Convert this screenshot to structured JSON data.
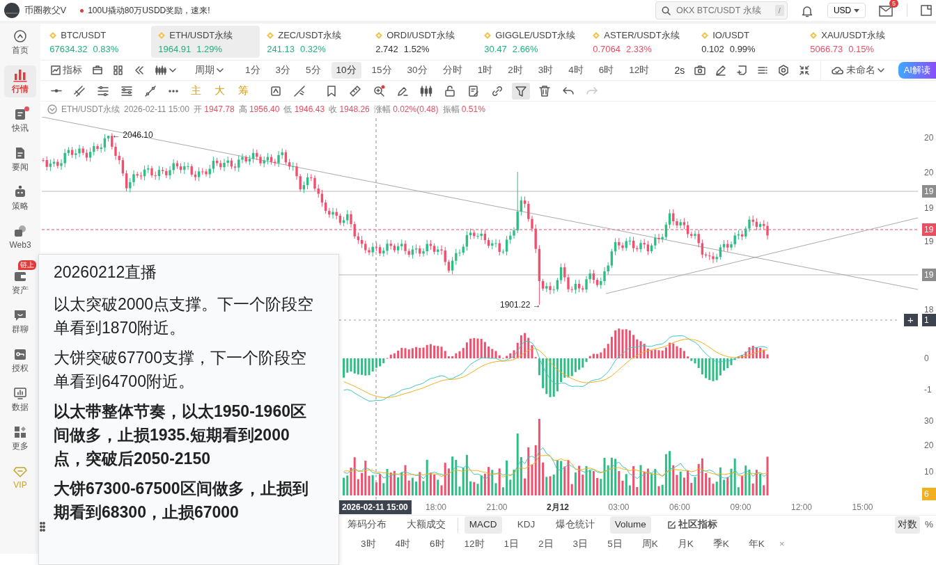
{
  "header": {
    "channel_name": "币圈教父V",
    "notice": "100U撬动80万USDD奖励，速来!",
    "search": {
      "placeholder": "OKX BTC/USDT 永续",
      "shortcut": "/"
    },
    "currency": "USD",
    "mail_badge": "5"
  },
  "sidebar": {
    "items": [
      {
        "label": "首页",
        "kind": "home",
        "selected": false,
        "unread": false
      },
      {
        "label": "行情",
        "kind": "market",
        "selected": true,
        "unread": false
      },
      {
        "label": "快讯",
        "kind": "flash",
        "selected": false,
        "unread": true
      },
      {
        "label": "要闻",
        "kind": "news",
        "selected": false,
        "unread": false
      },
      {
        "label": "策略",
        "kind": "strategy",
        "selected": false,
        "unread": false
      },
      {
        "label": "Web3",
        "kind": "web3",
        "selected": false,
        "unread": false
      },
      {
        "label": "资产",
        "kind": "assets",
        "selected": false,
        "unread": false,
        "badge": "链上"
      },
      {
        "label": "群聊",
        "kind": "chat",
        "selected": false,
        "unread": false
      },
      {
        "label": "授权",
        "kind": "auth",
        "selected": false,
        "unread": false
      },
      {
        "label": "数据",
        "kind": "data",
        "selected": false,
        "unread": false
      },
      {
        "label": "更多",
        "kind": "more",
        "selected": false,
        "unread": false
      },
      {
        "label": "VIP",
        "kind": "vip",
        "selected": false,
        "unread": false
      }
    ]
  },
  "tickers": [
    {
      "symbol": "BTC/USDT",
      "price": "67634.32",
      "change": "0.83%",
      "color": "#1db27c",
      "selected": false
    },
    {
      "symbol": "ETH/USDT永续",
      "price": "1964.91",
      "change": "1.29%",
      "color": "#1db27c",
      "selected": true
    },
    {
      "symbol": "ZEC/USDT永续",
      "price": "241.13",
      "change": "0.32%",
      "color": "#1db27c",
      "selected": false
    },
    {
      "symbol": "ORDI/USDT永续",
      "price": "2.742",
      "change": "1.52%",
      "color": "#333333",
      "selected": false
    },
    {
      "symbol": "GIGGLE/USDT永续",
      "price": "30.47",
      "change": "2.66%",
      "color": "#1db27c",
      "selected": false
    },
    {
      "symbol": "ASTER/USDT永续",
      "price": "0.7064",
      "change": "2.33%",
      "color": "#e84f63",
      "selected": false
    },
    {
      "symbol": "IO/USDT",
      "price": "0.102",
      "change": "0.99%",
      "color": "#333333",
      "selected": false
    },
    {
      "symbol": "XAU/USDT永续",
      "price": "5066.73",
      "change": "0.15%",
      "color": "#e84f63",
      "selected": false
    }
  ],
  "toolbar": {
    "indicator_label": "指标",
    "period_label": "周期",
    "periods": [
      {
        "label": "1分",
        "selected": false
      },
      {
        "label": "3分",
        "selected": false
      },
      {
        "label": "5分",
        "selected": false
      },
      {
        "label": "10分",
        "selected": true
      },
      {
        "label": "15分",
        "selected": false
      },
      {
        "label": "30分",
        "selected": false
      },
      {
        "label": "分时",
        "selected": false
      },
      {
        "label": "1时",
        "selected": false
      },
      {
        "label": "2时",
        "selected": false
      },
      {
        "label": "3时",
        "selected": false
      },
      {
        "label": "4时",
        "selected": false
      },
      {
        "label": "6时",
        "selected": false
      },
      {
        "label": "12时",
        "selected": false
      }
    ],
    "refresh": "2s",
    "layout_name": "未命名",
    "ai_button": "AI解读"
  },
  "drawing_tools": [
    {
      "kind": "hline",
      "selected": false,
      "disabled": false
    },
    {
      "kind": "parallel",
      "selected": false,
      "disabled": false
    },
    {
      "kind": "channel",
      "selected": false,
      "disabled": false
    },
    {
      "kind": "levels",
      "selected": false,
      "disabled": false
    },
    {
      "kind": "trend",
      "selected": false,
      "disabled": false
    },
    {
      "kind": "more",
      "selected": false,
      "disabled": false
    },
    {
      "kind": "text",
      "label": "主",
      "selected": false,
      "disabled": false
    },
    {
      "kind": "text",
      "label": "大",
      "selected": false,
      "disabled": false
    },
    {
      "kind": "text",
      "label": "筹",
      "selected": false,
      "disabled": false
    },
    {
      "kind": "rotate",
      "selected": false,
      "disabled": false
    },
    {
      "kind": "measure",
      "selected": false,
      "disabled": false
    },
    {
      "kind": "bookmark",
      "selected": false,
      "disabled": false
    },
    {
      "kind": "ruler",
      "selected": false,
      "disabled": false
    },
    {
      "kind": "zoom",
      "selected": false,
      "disabled": false
    },
    {
      "kind": "pen",
      "selected": false,
      "disabled": false
    },
    {
      "kind": "candles",
      "selected": false,
      "disabled": false
    },
    {
      "kind": "lock",
      "selected": false,
      "disabled": false
    },
    {
      "kind": "note",
      "selected": false,
      "disabled": false
    },
    {
      "kind": "link",
      "selected": false,
      "disabled": false
    },
    {
      "kind": "filter",
      "selected": true,
      "disabled": false
    },
    {
      "kind": "trash",
      "selected": false,
      "disabled": false
    },
    {
      "kind": "undo",
      "selected": false,
      "disabled": false
    },
    {
      "kind": "redo",
      "selected": false,
      "disabled": true
    }
  ],
  "chart": {
    "symbol": "ETH/USDT永续",
    "datetime": "2026-02-11 15:00",
    "fields": [
      {
        "label": "开",
        "value": "1947.78"
      },
      {
        "label": "高",
        "value": "1956.40"
      },
      {
        "label": "低",
        "value": "1946.43"
      },
      {
        "label": "收",
        "value": "1948.26"
      },
      {
        "label": "涨幅",
        "value": "0.02%(0.48)"
      },
      {
        "label": "振幅",
        "value": "0.51%"
      }
    ],
    "high_label": "← 2046.10",
    "low_label": "1901.22 →",
    "price_axis": [
      {
        "text": "20",
        "kind": "plain"
      },
      {
        "text": "20",
        "kind": "plain"
      },
      {
        "text": "19",
        "kind": "gray-tag"
      },
      {
        "text": "19",
        "kind": "plain"
      },
      {
        "text": "19",
        "kind": "red-tag"
      },
      {
        "text": "19",
        "kind": "plain"
      },
      {
        "text": "19",
        "kind": "gray-tag"
      },
      {
        "text": "18",
        "kind": "plain"
      },
      {
        "text": "1",
        "kind": "dark-tag"
      }
    ],
    "crosshair_add": "+",
    "macd_axis": [
      "0",
      "-1"
    ],
    "volume_axis": [
      {
        "text": "30",
        "kind": "plain"
      },
      {
        "text": "20",
        "kind": "plain"
      },
      {
        "text": "10",
        "kind": "plain"
      },
      {
        "text": "6",
        "kind": "yellow-tag"
      }
    ],
    "crosshair_time": "2026-02-11 15:00",
    "time_axis": [
      {
        "text": "18:00",
        "bold": false
      },
      {
        "text": "21:00",
        "bold": false
      },
      {
        "text": "2月12",
        "bold": true
      },
      {
        "text": "03:00",
        "bold": false
      },
      {
        "text": "06:00",
        "bold": false
      },
      {
        "text": "09:00",
        "bold": false
      },
      {
        "text": "12:00",
        "bold": false
      },
      {
        "text": "15:00",
        "bold": false
      }
    ]
  },
  "note": {
    "title": "20260212直播",
    "paragraphs": [
      {
        "text": "以太突破2000点支撑。下一个阶段空单看到1870附近。",
        "bold": false
      },
      {
        "text": "大饼突破67700支撑，下一个阶段空单看到64700附近。",
        "bold": false
      },
      {
        "text": "以太带整体节奏，以太1950-1960区间做多，止损1935.短期看到2000点，突破后2050-2150",
        "bold": true
      },
      {
        "text": "大饼67300-67500区间做多，止损到期看到68300，止损67000",
        "bold": true
      }
    ]
  },
  "indicator_tabs": [
    {
      "label": "筹码分布",
      "kind": "tab",
      "selected": false
    },
    {
      "label": "大额成交",
      "kind": "tab",
      "selected": false
    },
    {
      "label": "MACD",
      "kind": "tab",
      "selected": true
    },
    {
      "label": "KDJ",
      "kind": "tab",
      "selected": false
    },
    {
      "label": "爆仓统计",
      "kind": "tab",
      "selected": false
    },
    {
      "label": "Volume",
      "kind": "tab",
      "selected": true
    },
    {
      "label": "社区指标",
      "kind": "community",
      "selected": false
    }
  ],
  "scale_buttons": [
    {
      "label": "对数",
      "selected": true
    },
    {
      "label": "%",
      "selected": false
    }
  ],
  "quick_periods": [
    "3时",
    "4时",
    "6时",
    "12时",
    "1日",
    "2日",
    "3日",
    "5日",
    "周K",
    "月K",
    "季K",
    "年K"
  ],
  "close_label": "×"
}
